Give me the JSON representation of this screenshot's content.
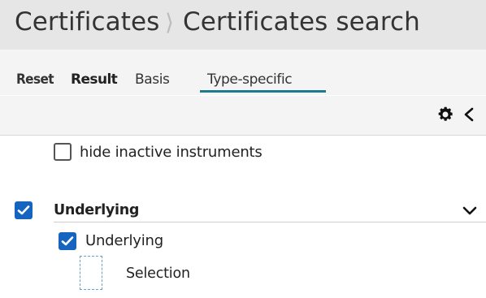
{
  "breadcrumb": {
    "items": [
      "Certificates",
      "Certificates search"
    ],
    "separator": "⟩"
  },
  "tabs": [
    {
      "label": "Reset",
      "active": false
    },
    {
      "label": "Result",
      "active": false
    },
    {
      "label": "Basis",
      "active": false
    },
    {
      "label": "Type-specific",
      "active": true
    }
  ],
  "toolbar": {
    "icons": [
      "gear-icon",
      "chevron-left-icon"
    ]
  },
  "filters": {
    "hide_inactive": {
      "label": "hide inactive instruments",
      "checked": false
    },
    "underlying_group": {
      "label": "Underlying",
      "checked": true,
      "expanded": true,
      "sub_checkbox": {
        "label": "Underlying",
        "checked": true
      },
      "selection": {
        "label": "Selection"
      }
    }
  },
  "colors": {
    "accent": "#1565c0",
    "tab_underline": "#1f7a8c",
    "header_bg": "#e6e6e6",
    "toolbar_bg": "#f4f4f4"
  }
}
